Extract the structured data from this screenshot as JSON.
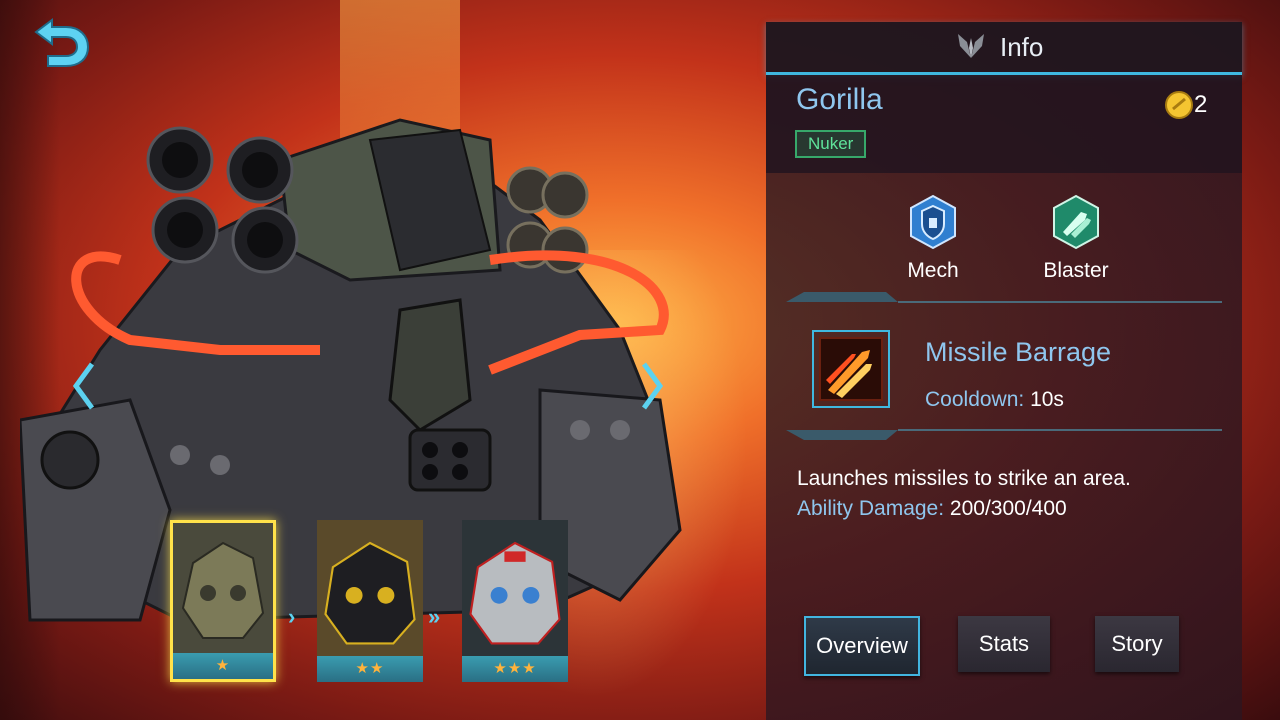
{
  "header": {
    "title": "Info",
    "icon": "wings-emblem-icon"
  },
  "hero": {
    "name": "Gorilla",
    "cost": "2",
    "role": "Nuker"
  },
  "classes": [
    {
      "label": "Mech",
      "icon": "shield-icon",
      "color": "#2f7fd0"
    },
    {
      "label": "Blaster",
      "icon": "missiles-icon",
      "color": "#1f8a6a"
    }
  ],
  "skill": {
    "name": "Missile Barrage",
    "cooldown_label": "Cooldown:",
    "cooldown_value": "10s",
    "description": "Launches missiles to strike an area.",
    "damage_label": "Ability Damage:",
    "damage_value": "200/300/400"
  },
  "skins": [
    {
      "stars": "★",
      "selected": true
    },
    {
      "stars": "★★",
      "selected": false
    },
    {
      "stars": "★★★",
      "selected": false
    }
  ],
  "tabs": {
    "overview": "Overview",
    "stats": "Stats",
    "story": "Story"
  },
  "colors": {
    "accent": "#3fb8e0",
    "name": "#8fc6ee",
    "role": "#5fe39a",
    "star": "#ffb33c",
    "selected": "#ffe24a"
  }
}
